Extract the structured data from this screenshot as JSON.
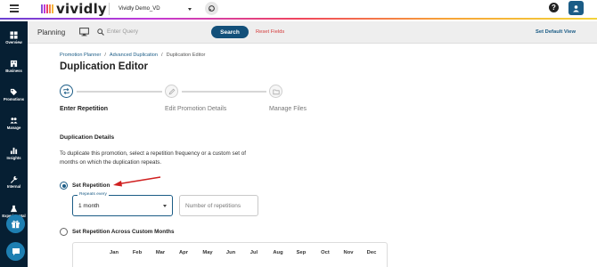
{
  "topbar": {
    "brand": "vividly",
    "brand_colors": [
      "#8a4fd8",
      "#c33ad6",
      "#e8456a",
      "#f3894a",
      "#f5b43a"
    ],
    "environment": "Vividly Demo_VD",
    "icons": {
      "menu": "hamburger-icon",
      "sync": "sync-icon",
      "help": "help-icon",
      "user": "user-icon"
    }
  },
  "sidebar": {
    "items": [
      {
        "label": "Overview",
        "icon": "grid-icon"
      },
      {
        "label": "Business",
        "icon": "building-icon"
      },
      {
        "label": "Promotions",
        "icon": "tag-icon"
      },
      {
        "label": "Manage",
        "icon": "people-icon"
      },
      {
        "label": "Insights",
        "icon": "bar-chart-icon"
      },
      {
        "label": "Internal",
        "icon": "wrench-icon"
      },
      {
        "label": "Experimental",
        "icon": "flask-icon"
      }
    ],
    "bg_color": "#061f33"
  },
  "filterbar": {
    "title": "Planning",
    "query_placeholder": "Enter Query",
    "search_label": "Search",
    "reset_label": "Reset Fields",
    "default_view_label": "Set Default View"
  },
  "breadcrumb": [
    "Promotion Planner",
    "Advanced Duplication",
    "Duplication Editor"
  ],
  "breadcrumb_sep": "/",
  "page_title": "Duplication Editor",
  "stepper": {
    "steps": [
      {
        "label": "Enter Repetition",
        "active": true
      },
      {
        "label": "Edit Promotion Details",
        "active": false
      },
      {
        "label": "Manage Files",
        "active": false
      }
    ]
  },
  "details": {
    "section_title": "Duplication Details",
    "description": "To duplicate this promotion, select a repetition frequency or a custom set of months on which the duplication repeats.",
    "option_repetition": "Set Repetition",
    "repeats_every_label": "Repeats every",
    "repeats_every_value": "1 month",
    "repetitions_placeholder": "Number of repetitions",
    "option_custom": "Set Repetition Across Custom Months",
    "selected_option": "Set Repetition",
    "months": [
      "Jan",
      "Feb",
      "Mar",
      "Apr",
      "May",
      "Jun",
      "Jul",
      "Aug",
      "Sep",
      "Oct",
      "Nov",
      "Dec"
    ]
  },
  "colors": {
    "primary": "#1b5c86",
    "reset": "#d43a3a",
    "arrow": "#d02020"
  }
}
